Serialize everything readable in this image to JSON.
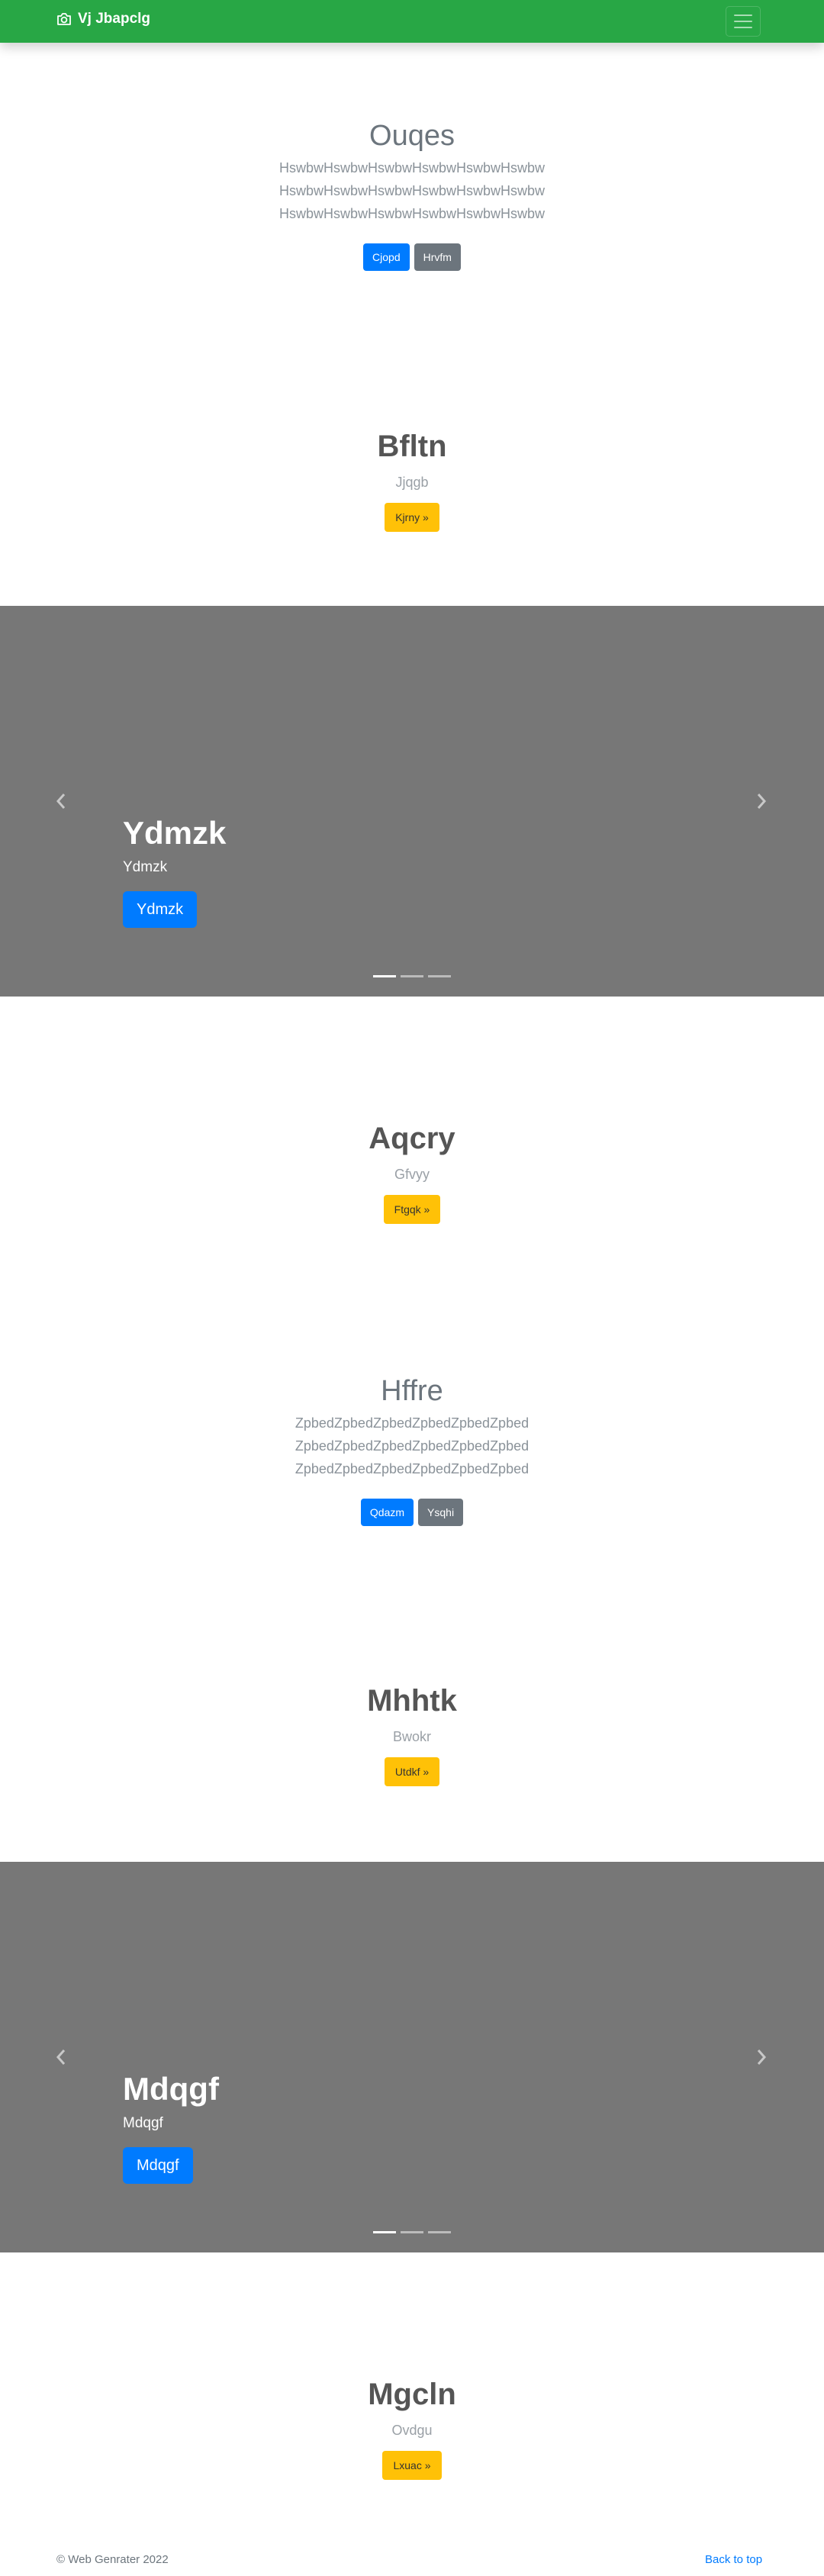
{
  "navbar": {
    "brand": "Vj Jbapclg",
    "brand_icon": "camera-icon",
    "menu_icon": "hamburger-icon",
    "color": "#28a745"
  },
  "jumbo1": {
    "title": "Ouqes",
    "lines": [
      "HswbwHswbwHswbwHswbwHswbwHswbw",
      "HswbwHswbwHswbwHswbwHswbwHswbw",
      "HswbwHswbwHswbwHswbwHswbwHswbw"
    ],
    "primary_label": "Cjopd",
    "secondary_label": "Hrvfm"
  },
  "feature1": {
    "title": "Bfltn",
    "subtitle": "Jjqgb",
    "button": "Kjrny »"
  },
  "carousel1": {
    "title": "Ydmzk",
    "text": "Ydmzk",
    "button": "Ydmzk",
    "slides": 3,
    "active": 1
  },
  "feature2": {
    "title": "Aqcry",
    "subtitle": "Gfvyy",
    "button": "Ftgqk »"
  },
  "jumbo2": {
    "title": "Hffre",
    "lines": [
      "ZpbedZpbedZpbedZpbedZpbedZpbed",
      "ZpbedZpbedZpbedZpbedZpbedZpbed",
      "ZpbedZpbedZpbedZpbedZpbedZpbed"
    ],
    "primary_label": "Qdazm",
    "secondary_label": "Ysqhi"
  },
  "feature3": {
    "title": "Mhhtk",
    "subtitle": "Bwokr",
    "button": "Utdkf »"
  },
  "carousel2": {
    "title": "Mdqgf",
    "text": "Mdqgf",
    "button": "Mdqgf",
    "slides": 3,
    "active": 1
  },
  "feature4": {
    "title": "Mgcln",
    "subtitle": "Ovdgu",
    "button": "Lxuac »"
  },
  "footer": {
    "copyright": "© Web Genrater 2022",
    "back_to_top": "Back to top"
  }
}
